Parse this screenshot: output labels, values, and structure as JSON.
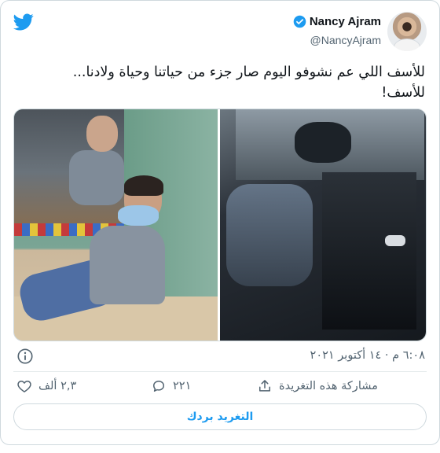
{
  "colors": {
    "accent": "#1d9bf0",
    "text": "#0f1419",
    "muted": "#536471",
    "border": "#cfd9de"
  },
  "header": {
    "display_name": "Nancy Ajram",
    "handle": "@NancyAjram",
    "verified_icon": "verified-badge-icon",
    "brand_icon": "twitter-bird-icon"
  },
  "tweet": {
    "text": "للأسف اللي عم نشوفو اليوم صار جزء من حياتنا وحياة ولادنا...\nللأسف!"
  },
  "media": {
    "count": 2
  },
  "meta": {
    "timestamp": "٦:٠٨ م · ١٤ أكتوبر ٢٠٢١",
    "info_icon": "info-icon"
  },
  "actions": {
    "likes": "٢,٣ ألف",
    "replies": "٢٢١",
    "share_label": "مشاركة هذه التغريدة"
  },
  "read_replies_label": "التغريد بردك"
}
